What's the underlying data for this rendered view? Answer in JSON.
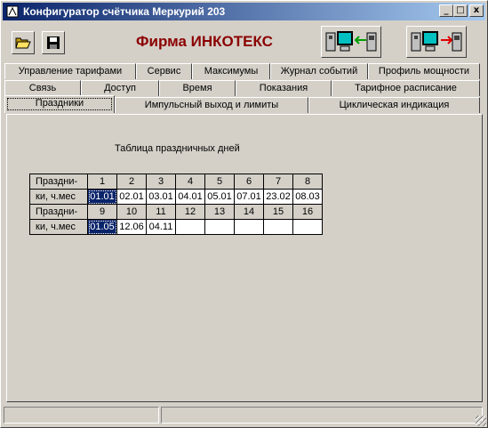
{
  "window": {
    "title": "Конфигуратор счётчика Меркурий 203",
    "minimize": "_",
    "maximize": "□",
    "close": "x"
  },
  "toolbar": {
    "brand": "Фирма ИНКОТЕКС",
    "brand_color": "#8b0000",
    "open_icon": "folder-open-icon",
    "save_icon": "floppy-disk-icon",
    "read_icon": "read-from-meter-icon",
    "write_icon": "write-to-meter-icon"
  },
  "tabs": {
    "row1": [
      "Управление тарифами",
      "Сервис",
      "Максимумы",
      "Журнал событий",
      "Профиль мощности"
    ],
    "row2": [
      "Связь",
      "Доступ",
      "Время",
      "Показания",
      "Тарифное расписание"
    ],
    "row3": [
      "Праздники",
      "Импульсный выход и лимиты",
      "Циклическая индикация"
    ],
    "active": "Праздники"
  },
  "holidays": {
    "title": "Таблица праздничных дней",
    "row_label_top": "Праздни-",
    "row_label_bottom": "ки, ч.мес",
    "row_label_bottom2": "ки, ч.мес",
    "numbers_1": [
      "1",
      "2",
      "3",
      "4",
      "5",
      "6",
      "7",
      "8"
    ],
    "values_1": [
      "01.01",
      "02.01",
      "03.01",
      "04.01",
      "05.01",
      "07.01",
      "23.02",
      "08.03"
    ],
    "numbers_2": [
      "9",
      "10",
      "11",
      "12",
      "13",
      "14",
      "15",
      "16"
    ],
    "values_2": [
      "01.05",
      "12.06",
      "04.11",
      "",
      "",
      "",
      "",
      ""
    ],
    "selected_color": "#0a246a"
  },
  "statusbar": {
    "left": "",
    "right": ""
  }
}
